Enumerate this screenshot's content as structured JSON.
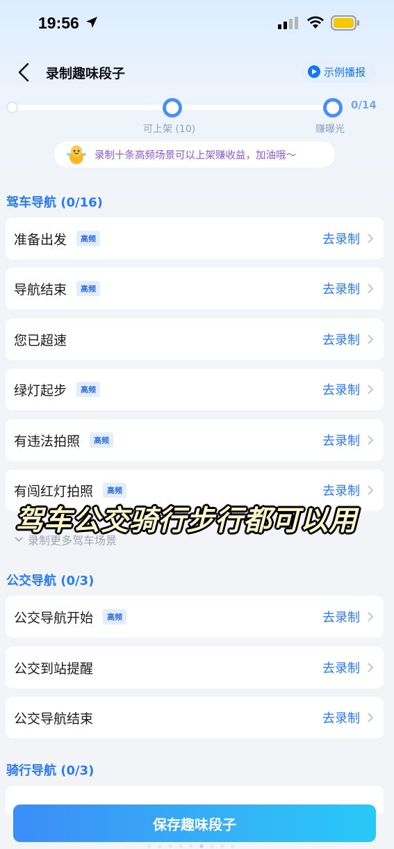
{
  "status_bar": {
    "time": "19:56"
  },
  "nav": {
    "title": "录制趣味段子",
    "demo_label": "示例播报"
  },
  "progress": {
    "count": "0/14",
    "milestone_1": "可上架 (10)",
    "milestone_2": "赚曝光"
  },
  "tip": {
    "text": "录制十条高频场景可以上架赚收益，加油哦～"
  },
  "sections": [
    {
      "title": "驾车导航 (0/16)",
      "items": [
        {
          "label": "准备出发",
          "badge": "高频",
          "action": "去录制"
        },
        {
          "label": "导航结束",
          "badge": "高频",
          "action": "去录制"
        },
        {
          "label": "您已超速",
          "badge": "",
          "action": "去录制"
        },
        {
          "label": "绿灯起步",
          "badge": "高频",
          "action": "去录制"
        },
        {
          "label": "有违法拍照",
          "badge": "高频",
          "action": "去录制"
        },
        {
          "label": "有闯红灯拍照",
          "badge": "高频",
          "action": "去录制"
        }
      ],
      "more_label": "录制更多驾车场景"
    },
    {
      "title": "公交导航 (0/3)",
      "items": [
        {
          "label": "公交导航开始",
          "badge": "高频",
          "action": "去录制"
        },
        {
          "label": "公交到站提醒",
          "badge": "",
          "action": "去录制"
        },
        {
          "label": "公交导航结束",
          "badge": "",
          "action": "去录制"
        }
      ]
    },
    {
      "title": "骑行导航 (0/3)",
      "items": []
    }
  ],
  "overlay_caption": "驾车公交骑行步行都可以用",
  "save_button": "保存趣味段子",
  "colors": {
    "accent": "#2b7bf2",
    "badge_bg": "#e3edfc",
    "tip_text": "#8a5bd6"
  }
}
